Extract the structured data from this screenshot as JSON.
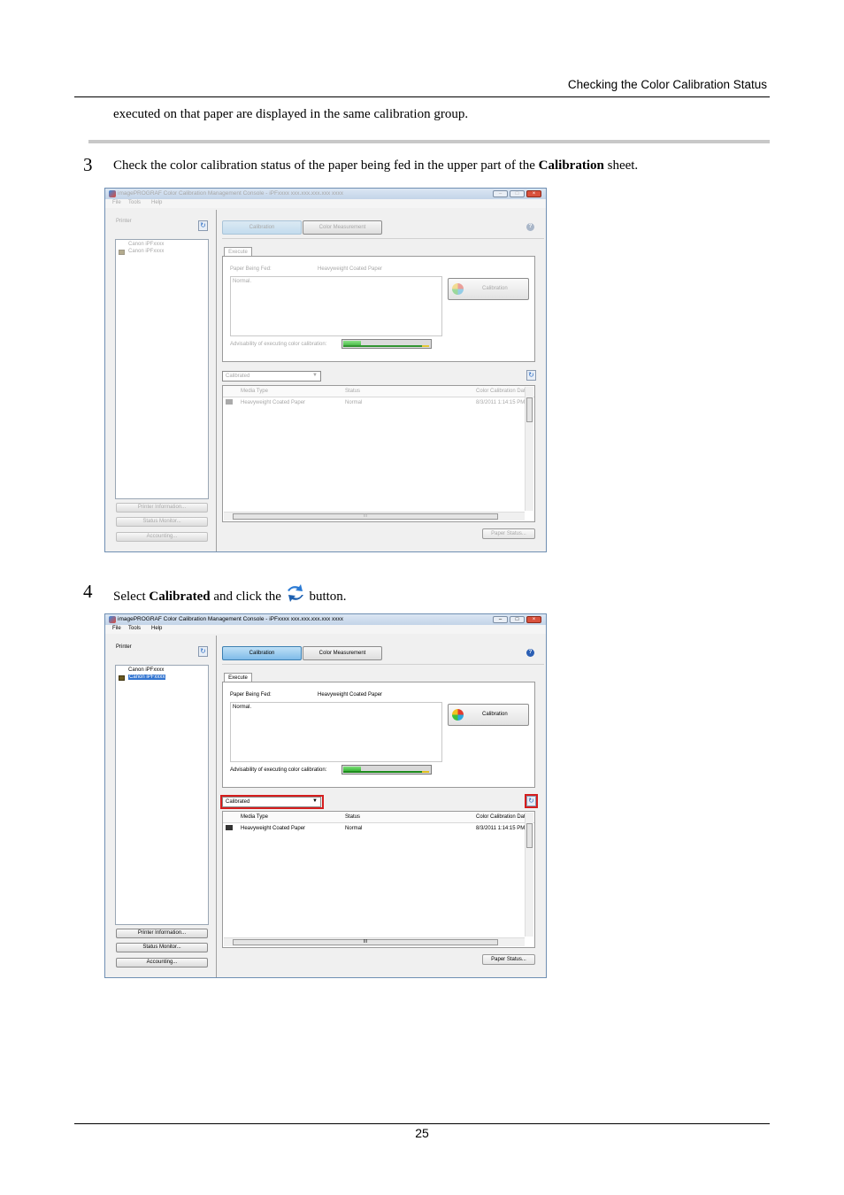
{
  "header": {
    "section_title": "Checking the Color Calibration Status"
  },
  "intro_text": "executed on that paper are displayed in the same calibration group.",
  "step3": {
    "number": "3",
    "text_before": "Check the color calibration status of the paper being fed in the upper part of the ",
    "bold": "Calibration",
    "text_after": " sheet."
  },
  "step4": {
    "number": "4",
    "text_before": "Select ",
    "bold": "Calibrated",
    "text_mid": " and click the ",
    "text_after": " button.",
    "inline_icon": "refresh-icon"
  },
  "window": {
    "title": "imagePROGRAF Color Calibration Management Console - iPFxxxx xxx.xxx.xxx.xxx xxxx",
    "menu": [
      "File",
      "Tools",
      "Help"
    ],
    "printer_label": "Printer",
    "printers": [
      "Canon iPFxxxx",
      "Canon iPFxxxx"
    ],
    "left_buttons": [
      "Printer Information...",
      "Status Monitor...",
      "Accounting..."
    ],
    "tabs": [
      "Calibration",
      "Color Measurement"
    ],
    "help_glyph": "?",
    "subtab": "Execute",
    "paper_fed_label": "Paper Being Fed:",
    "paper_fed_value": "Heavyweight Coated Paper",
    "status_note": "Normal.",
    "advisability_label": "Advisability of executing color calibration:",
    "advisability_level": 0.2,
    "calibration_button": "Calibration",
    "dropdown_value": "Calibrated",
    "columns": [
      "Media Type",
      "Status",
      "Color Calibration Date"
    ],
    "rows": [
      {
        "media": "Heavyweight Coated Paper",
        "status": "Normal",
        "date": "8/3/2011 1:14:15 PM"
      }
    ],
    "scroll_grip": "III",
    "paper_status_button": "Paper Status..."
  },
  "colors": {
    "highlight_red": "#d51e1e",
    "accent_blue": "#3c7fb1"
  },
  "footer": {
    "page_number": "25"
  }
}
